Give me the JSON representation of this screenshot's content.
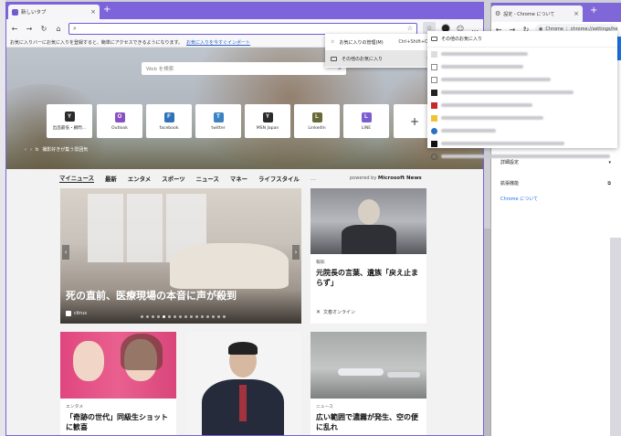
{
  "edge": {
    "tab_title": "新しいタブ",
    "address_value": "",
    "fav_hint_text": "お気に入りバーにお気に入りを登録すると、簡単にアクセスできるようになります。",
    "fav_hint_link": "お気に入りを今すぐインポート",
    "search_placeholder": "Web を検索",
    "photo_caption": "撮影好きが集う雰囲気",
    "tiles": [
      {
        "label": "出品最低・顧問…",
        "letter": "Y",
        "color": "#2b2b2b"
      },
      {
        "label": "Outlook",
        "letter": "O",
        "color": "#8a4fc2"
      },
      {
        "label": "facebook",
        "letter": "F",
        "color": "#2f74b8"
      },
      {
        "label": "twitter",
        "letter": "T",
        "color": "#3a84c4"
      },
      {
        "label": "MSN Japan",
        "letter": "Y",
        "color": "#2b2b2b"
      },
      {
        "label": "LinkedIn",
        "letter": "L",
        "color": "#6a6a38"
      },
      {
        "label": "LINE",
        "letter": "L",
        "color": "#7a5ed0"
      }
    ],
    "news_tabs": [
      "マイニュース",
      "最新",
      "エンタメ",
      "スポーツ",
      "ニュース",
      "マネー",
      "ライフスタイル",
      "…"
    ],
    "powered_by": "powered by",
    "powered_brand": "Microsoft News",
    "cards": {
      "main": {
        "title": "死の直前、医療現場の本音に声が殺到",
        "source": "citrus"
      },
      "c2": {
        "tag": "報知",
        "title": "元院長の言葉、遺族「戻え止まらず」",
        "source": "文春オンライン"
      },
      "c3": {
        "tag": "エンタメ",
        "title": "「奇跡の世代」同級生ショットに歓喜"
      },
      "c5": {
        "tag": "ニュース",
        "title": "広い範囲で濃霧が発生、空の便に乱れ"
      }
    },
    "fav_menu": [
      {
        "label": "お気に入りの管理(M)",
        "shortcut": "Ctrl+Shift+O"
      },
      {
        "label": "その他のお気に入り",
        "shortcut": "›"
      }
    ],
    "other_fav_header": "その他のお気に入り"
  },
  "chrome": {
    "tab_title": "設定 - Chrome について",
    "omni_site": "Chrome",
    "omni_path": "chrome://settings/he",
    "settings_title": "設定",
    "rows": {
      "advanced": "詳細設定",
      "extensions": "拡張機能",
      "about": "Chrome について"
    }
  },
  "colors": {
    "edge_accent": "#7e64da",
    "chrome_blue": "#1a73e8"
  }
}
